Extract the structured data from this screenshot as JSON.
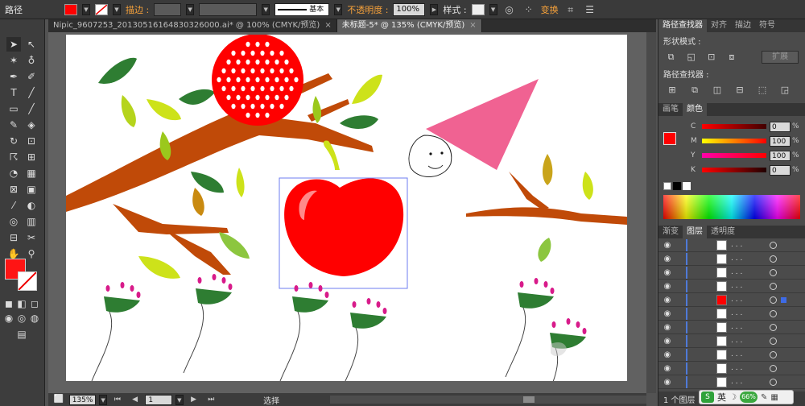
{
  "topbar": {
    "path_label": "路径",
    "fill_color": "#ff0000",
    "stroke_label": "描边 :",
    "brush_label": "基本",
    "opacity_label": "不透明度 :",
    "opacity_value": "100%",
    "style_label": "样式 :",
    "transform_label": "变换"
  },
  "tabs": [
    {
      "label": "Nipic_9607253_20130516164830326000.ai* @ 100% (CMYK/预览)",
      "close": "×"
    },
    {
      "label": "未标题-5* @ 135% (CMYK/预览)",
      "close": "×"
    }
  ],
  "status": {
    "zoom": "135%",
    "page": "1",
    "tool": "选择"
  },
  "pathfinder": {
    "tabs": [
      "路径查找器",
      "对齐",
      "描边",
      "符号"
    ],
    "shape_modes_label": "形状模式 :",
    "expand_label": "扩展",
    "pathfinders_label": "路径查找器 :"
  },
  "color": {
    "tabs": [
      "画笔",
      "颜色"
    ],
    "channels": [
      {
        "name": "C",
        "value": "0",
        "unit": "%",
        "gradient": "linear-gradient(to right,#ff0000,#400000)"
      },
      {
        "name": "M",
        "value": "100",
        "unit": "%",
        "gradient": "linear-gradient(to right,#ffff00,#ff0000)"
      },
      {
        "name": "Y",
        "value": "100",
        "unit": "%",
        "gradient": "linear-gradient(to right,#ff00aa,#ff0000)"
      },
      {
        "name": "K",
        "value": "0",
        "unit": "%",
        "gradient": "linear-gradient(to right,#ff0000,#200000)"
      }
    ]
  },
  "layers": {
    "tabs": [
      "渐变",
      "图层",
      "透明度"
    ],
    "row_label": ". . .",
    "footer": "1 个图层"
  },
  "ime": {
    "lang": "英",
    "percent": "66%"
  }
}
